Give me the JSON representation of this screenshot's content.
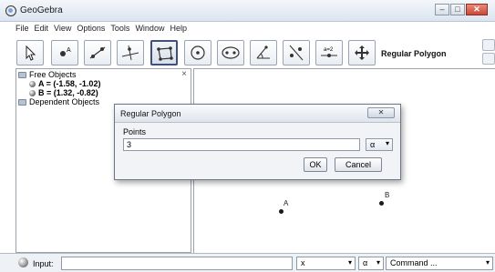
{
  "window": {
    "title": "GeoGebra"
  },
  "menubar": [
    "File",
    "Edit",
    "View",
    "Options",
    "Tools",
    "Window",
    "Help"
  ],
  "toolbar": {
    "tools": [
      {
        "name": "move-tool",
        "icon": "cursor-arrow-icon"
      },
      {
        "name": "point-tool",
        "icon": "point-icon"
      },
      {
        "name": "line-tool",
        "icon": "line-icon"
      },
      {
        "name": "perpendicular-tool",
        "icon": "perpendicular-line-icon"
      },
      {
        "name": "polygon-tool",
        "icon": "polygon-icon",
        "selected": true
      },
      {
        "name": "circle-tool",
        "icon": "circle-icon"
      },
      {
        "name": "conic-tool",
        "icon": "ellipse-icon"
      },
      {
        "name": "angle-tool",
        "icon": "angle-icon"
      },
      {
        "name": "reflect-tool",
        "icon": "reflect-icon"
      },
      {
        "name": "slider-tool",
        "icon": "slider-icon",
        "text": "a=2"
      },
      {
        "name": "move-graphics-tool",
        "icon": "move-arrows-icon"
      }
    ],
    "mode_label": "Regular Polygon"
  },
  "algebra": {
    "free_objects_label": "Free Objects",
    "points": [
      {
        "label": "A = (-1.58, -1.02)"
      },
      {
        "label": "B = (1.32, -0.82)"
      }
    ],
    "dependent_objects_label": "Dependent Objects",
    "close_glyph": "×"
  },
  "graphics": {
    "points": [
      {
        "name": "A"
      },
      {
        "name": "B"
      }
    ]
  },
  "dialog": {
    "title": "Regular Polygon",
    "field_label": "Points",
    "field_value": "3",
    "symbol_button": "α",
    "ok_label": "OK",
    "cancel_label": "Cancel"
  },
  "inputbar": {
    "label": "Input:",
    "combo_1": "x",
    "combo_2": "α",
    "combo_3": "Command ..."
  }
}
